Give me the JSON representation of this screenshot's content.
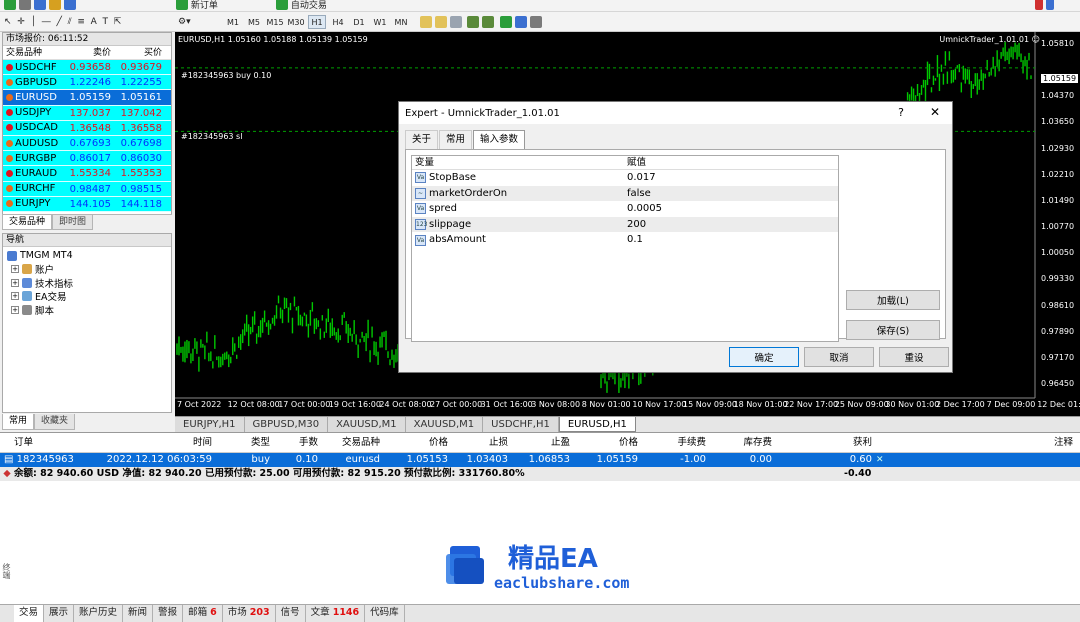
{
  "toolbar": {
    "new_order": "新订单",
    "auto_trading": "自动交易",
    "timeframes": [
      "M1",
      "M5",
      "M15",
      "M30",
      "H1",
      "H4",
      "D1",
      "W1",
      "MN"
    ],
    "active_timeframe": "H1"
  },
  "market_watch": {
    "title": "市场报价: 06:11:52",
    "col_symbol": "交易品种",
    "col_bid": "卖价",
    "col_ask": "买价",
    "rows": [
      {
        "symbol": "USDCHF",
        "bid": "0.93658",
        "ask": "0.93679",
        "dir": "down"
      },
      {
        "symbol": "GBPUSD",
        "bid": "1.22246",
        "ask": "1.22255",
        "dir": "up"
      },
      {
        "symbol": "EURUSD",
        "bid": "1.05159",
        "ask": "1.05161",
        "dir": "up",
        "selected": true
      },
      {
        "symbol": "USDJPY",
        "bid": "137.037",
        "ask": "137.042",
        "dir": "down"
      },
      {
        "symbol": "USDCAD",
        "bid": "1.36548",
        "ask": "1.36558",
        "dir": "down"
      },
      {
        "symbol": "AUDUSD",
        "bid": "0.67693",
        "ask": "0.67698",
        "dir": "up"
      },
      {
        "symbol": "EURGBP",
        "bid": "0.86017",
        "ask": "0.86030",
        "dir": "up"
      },
      {
        "symbol": "EURAUD",
        "bid": "1.55334",
        "ask": "1.55353",
        "dir": "down"
      },
      {
        "symbol": "EURCHF",
        "bid": "0.98487",
        "ask": "0.98515",
        "dir": "up"
      },
      {
        "symbol": "EURJPY",
        "bid": "144.105",
        "ask": "144.118",
        "dir": "up"
      }
    ],
    "tabs": [
      "交易品种",
      "即时图"
    ]
  },
  "navigator": {
    "title": "导航",
    "root": "TMGM MT4",
    "items": [
      "账户",
      "技术指标",
      "EA交易",
      "脚本"
    ],
    "tabs": [
      "常用",
      "收藏夹"
    ]
  },
  "chart": {
    "header": "EURUSD,H1  1.05160 1.05188 1.05139 1.05159",
    "ea_label": "UmnickTrader_1.01.01 ☺",
    "order_line_buy": "#182345963 buy 0.10",
    "order_line_sl": "#182345963 sl",
    "current_price": "1.05159",
    "price_ticks": [
      "1.05810",
      "1.04370",
      "1.03650",
      "1.02930",
      "1.02210",
      "1.01490",
      "1.00770",
      "1.00050",
      "0.99330",
      "0.98610",
      "0.97890",
      "0.97170",
      "0.96450"
    ],
    "time_ticks": [
      "7 Oct 2022",
      "12 Oct 08:00",
      "17 Oct 00:00",
      "19 Oct 16:00",
      "24 Oct 08:00",
      "27 Oct 00:00",
      "31 Oct 16:00",
      "3 Nov 08:00",
      "8 Nov 01:00",
      "10 Nov 17:00",
      "15 Nov 09:00",
      "18 Nov 01:00",
      "22 Nov 17:00",
      "25 Nov 09:00",
      "30 Nov 01:00",
      "2 Dec 17:00",
      "7 Dec 09:00",
      "12 Dec 01:00"
    ],
    "tabs": [
      "EURJPY,H1",
      "GBPUSD,M30",
      "XAUUSD,M1",
      "XAUUSD,M1",
      "USDCHF,H1",
      "EURUSD,H1"
    ],
    "active_tab": "EURUSD,H1",
    "colors": {
      "candles": "#00c800",
      "background": "#000000",
      "grid": "#3a3a3a",
      "trade_line": "#00a000"
    }
  },
  "dialog": {
    "title": "Expert - UmnickTrader_1.01.01",
    "help": "?",
    "close": "✕",
    "tabs": [
      "关于",
      "常用",
      "输入参数"
    ],
    "active_tab": "输入参数",
    "col_var": "变量",
    "col_val": "赋值",
    "params": [
      {
        "name": "StopBase",
        "value": "0.017",
        "type": "num"
      },
      {
        "name": "marketOrderOn",
        "value": "false",
        "type": "bool"
      },
      {
        "name": "spred",
        "value": "0.0005",
        "type": "num"
      },
      {
        "name": "slippage",
        "value": "200",
        "type": "int"
      },
      {
        "name": "absAmount",
        "value": "0.1",
        "type": "num"
      }
    ],
    "load_button": "加载(L)",
    "save_button": "保存(S)",
    "ok_button": "确定",
    "cancel_button": "取消",
    "reset_button": "重设"
  },
  "terminal": {
    "headers": [
      "订单",
      "时间",
      "类型",
      "手数",
      "交易品种",
      "价格",
      "止损",
      "止盈",
      "价格",
      "手续费",
      "库存费",
      "获利",
      "注释"
    ],
    "order": {
      "id": "182345963",
      "time": "2022.12.12 06:03:59",
      "type": "buy",
      "lots": "0.10",
      "symbol": "eurusd",
      "price": "1.05153",
      "sl": "1.03403",
      "tp": "1.06853",
      "current": "1.05159",
      "commission": "-1.00",
      "swap": "0.00",
      "profit": "0.60"
    },
    "balance_line": "余额: 82 940.60 USD  净值: 82 940.20  已用预付款: 25.00  可用预付款: 82 915.20  预付款比例: 331760.80%",
    "total_profit": "-0.40",
    "side_label": "终端"
  },
  "bottom_tabs": [
    {
      "label": "交易",
      "badge": ""
    },
    {
      "label": "展示",
      "badge": ""
    },
    {
      "label": "账户历史",
      "badge": ""
    },
    {
      "label": "新闻",
      "badge": ""
    },
    {
      "label": "警报",
      "badge": ""
    },
    {
      "label": "邮箱",
      "badge": "6"
    },
    {
      "label": "市场",
      "badge": "203"
    },
    {
      "label": "信号",
      "badge": ""
    },
    {
      "label": "文章",
      "badge": "1146"
    },
    {
      "label": "代码库",
      "badge": ""
    }
  ],
  "watermark": {
    "brand": "精品EA",
    "site": "eaclubshare.com",
    "color": "#1f5fd8"
  }
}
